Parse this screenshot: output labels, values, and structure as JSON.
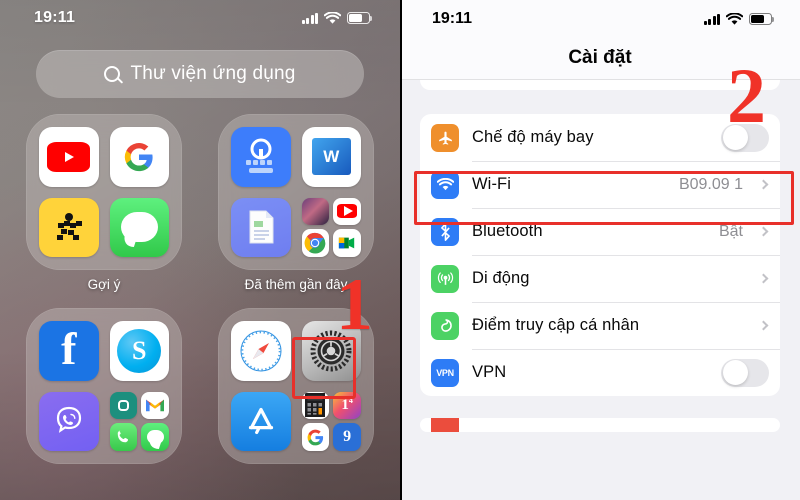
{
  "left_panel": {
    "status_bar": {
      "time": "19:11",
      "signal_icon": "cellular-bars-icon",
      "wifi_icon": "wifi-icon",
      "battery_icon": "battery-icon"
    },
    "search": {
      "label": "Thư viện ứng dụng",
      "icon": "search-icon"
    },
    "folders": [
      {
        "label": "Gợi ý",
        "apps": [
          "YouTube",
          "Google",
          "Gojek",
          "Tin nhắn"
        ]
      },
      {
        "label": "Đã thêm gần đây",
        "apps": [
          "Laban Key",
          "Word",
          "Tệp",
          "Liên Quân",
          "YouTube",
          "Chrome",
          "Meet"
        ]
      },
      {
        "label": "",
        "apps": [
          "Facebook",
          "Skype",
          "Viber",
          "Tìm",
          "Gmail",
          "Điện thoại",
          "Tin nhắn"
        ]
      },
      {
        "label": "",
        "apps": [
          "Safari",
          "Cài đặt",
          "App Store",
          "Máy tính",
          "Lịch",
          "Google",
          "Zalo"
        ]
      }
    ],
    "annotations": {
      "step_1": "1",
      "highlight_target": "settings-app-icon"
    }
  },
  "right_panel": {
    "status_bar": {
      "time": "19:11",
      "signal_icon": "cellular-bars-icon",
      "wifi_icon": "wifi-icon",
      "battery_icon": "battery-icon"
    },
    "nav_title": "Cài đặt",
    "rows": [
      {
        "label": "Chế độ máy bay",
        "icon": "airplane-icon",
        "control": "toggle",
        "toggle_on": false
      },
      {
        "label": "Wi-Fi",
        "icon": "wifi-icon",
        "control": "chevron",
        "value": "B09.09 1"
      },
      {
        "label": "Bluetooth",
        "icon": "bluetooth-icon",
        "control": "chevron",
        "value": "Bật"
      },
      {
        "label": "Di động",
        "icon": "cellular-icon",
        "control": "chevron",
        "value": ""
      },
      {
        "label": "Điểm truy cập cá nhân",
        "icon": "hotspot-icon",
        "control": "chevron",
        "value": ""
      },
      {
        "label": "VPN",
        "icon": "vpn-icon",
        "control": "toggle",
        "toggle_on": false
      }
    ],
    "annotations": {
      "step_2": "2",
      "highlight_target": "settings-row-cellular"
    },
    "colors": {
      "accent_red": "#e8302a",
      "page_bg": "#f1f1f5",
      "card_bg": "#ffffff",
      "value_gray": "#8e8e93"
    }
  }
}
